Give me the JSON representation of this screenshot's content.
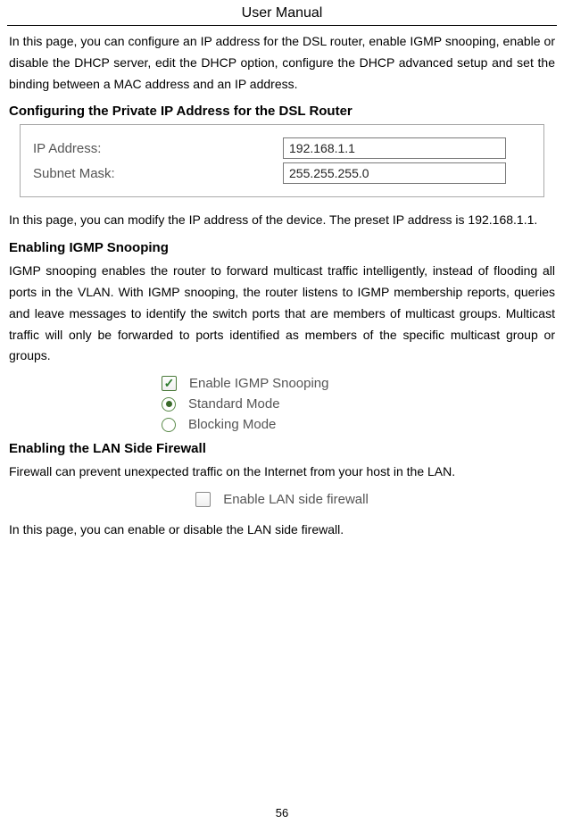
{
  "header": {
    "title": "User Manual"
  },
  "intro": {
    "text": "In this page, you can configure an IP address for the DSL router, enable IGMP snooping, enable or disable the DHCP server, edit the DHCP option, configure the DHCP advanced setup and set the binding between a MAC address and an IP address."
  },
  "section1": {
    "heading": "Configuring the Private IP Address for the DSL Router",
    "ip_label": "IP Address:",
    "ip_value": "192.168.1.1",
    "mask_label": "Subnet Mask:",
    "mask_value": "255.255.255.0",
    "after_text": "In this page, you can modify the IP address of the device. The preset IP address is 192.168.1.1."
  },
  "section2": {
    "heading": "Enabling IGMP Snooping",
    "text": "IGMP snooping enables the router to forward multicast traffic intelligently, instead of flooding all ports in the VLAN. With IGMP snooping, the router listens to IGMP membership reports, queries and leave messages to identify the switch ports that are members of multicast groups. Multicast traffic will only be forwarded to ports identified as members of the specific multicast group or groups.",
    "enable_label": "Enable IGMP Snooping",
    "standard_label": "Standard Mode",
    "blocking_label": "Blocking Mode"
  },
  "section3": {
    "heading": "Enabling the LAN Side Firewall",
    "text": "Firewall can prevent unexpected traffic on the Internet from your host in the LAN.",
    "enable_label": "Enable LAN side firewall",
    "after_text": "In this page, you can enable or disable the LAN side firewall."
  },
  "footer": {
    "page_number": "56"
  }
}
